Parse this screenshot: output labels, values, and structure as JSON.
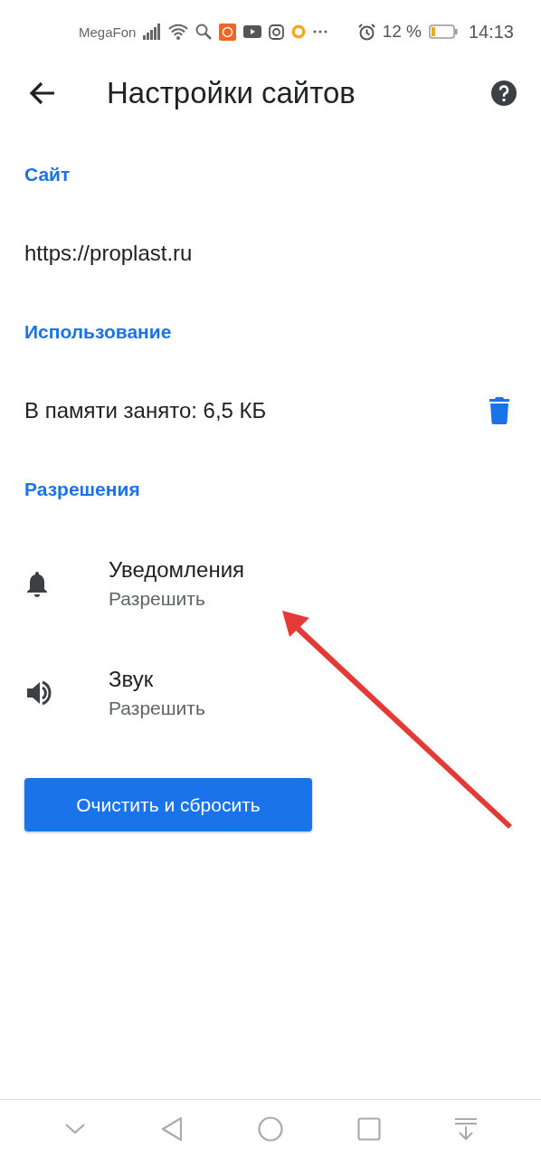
{
  "status_bar": {
    "carrier": "MegaFon",
    "battery_percent": "12 %",
    "time": "14:13"
  },
  "header": {
    "title": "Настройки сайтов"
  },
  "sections": [
    {
      "title": "Сайт",
      "rows": [
        {
          "kind": "text",
          "text": "https://proplast.ru"
        }
      ]
    },
    {
      "title": "Использование",
      "rows": [
        {
          "kind": "storage",
          "text": "В памяти занято: 6,5 КБ"
        }
      ]
    },
    {
      "title": "Разрешения",
      "rows": [
        {
          "kind": "bell",
          "text": "Уведомления",
          "subtitle": "Разрешить"
        },
        {
          "kind": "speaker",
          "text": "Звук",
          "subtitle": "Разрешить"
        }
      ]
    }
  ],
  "reset_button": "Очистить и сбросить"
}
